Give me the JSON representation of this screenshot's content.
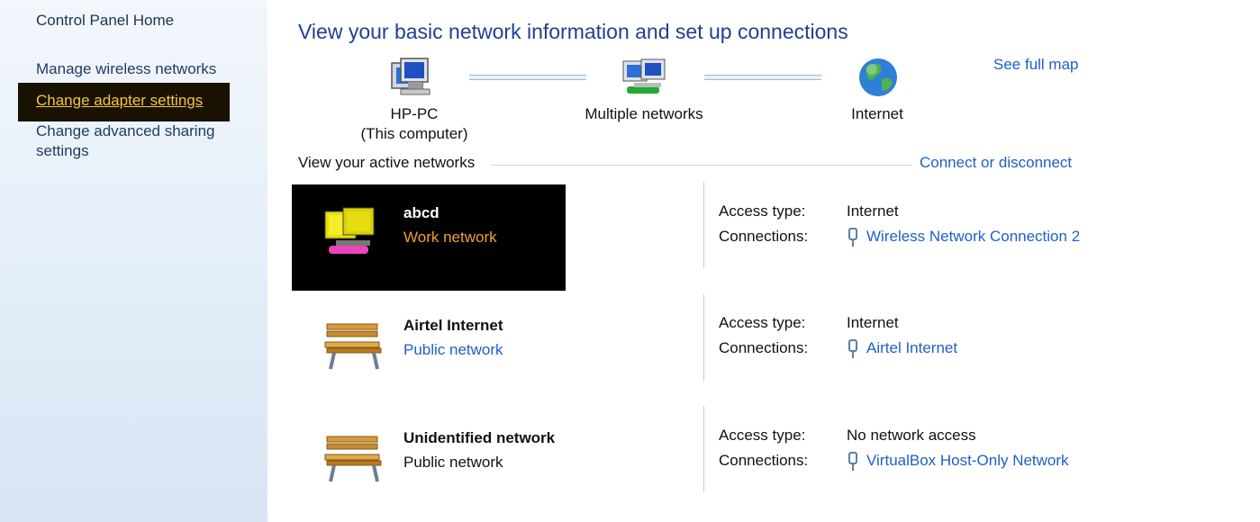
{
  "sidebar": {
    "home": "Control Panel Home",
    "items": [
      {
        "label": "Manage wireless networks"
      },
      {
        "label": "Change adapter settings"
      },
      {
        "label": "Change advanced sharing\nsettings"
      }
    ]
  },
  "main": {
    "title": "View your basic network information and set up connections",
    "map": {
      "computer": {
        "name": "HP-PC",
        "sub": "(This computer)"
      },
      "middle": {
        "name": "Multiple networks"
      },
      "internet": {
        "name": "Internet"
      },
      "see_full_map": "See full map"
    },
    "active_label": "View your active networks",
    "connect_label": "Connect or disconnect",
    "networks": [
      {
        "name": "abcd",
        "type": "Work network",
        "access_label": "Access type:",
        "access_value": "Internet",
        "conn_label": "Connections:",
        "conn_value": "Wireless Network Connection 2"
      },
      {
        "name": "Airtel Internet",
        "type": "Public network",
        "access_label": "Access type:",
        "access_value": "Internet",
        "conn_label": "Connections:",
        "conn_value": "Airtel Internet"
      },
      {
        "name": "Unidentified network",
        "type": "Public network",
        "access_label": "Access type:",
        "access_value": "No network access",
        "conn_label": "Connections:",
        "conn_value": "VirtualBox Host-Only Network"
      }
    ]
  },
  "colors": {
    "title": "#1f3f93",
    "link": "#1f5fc8",
    "highlight_text": "#f5c342",
    "work_network": "#f0a030"
  }
}
